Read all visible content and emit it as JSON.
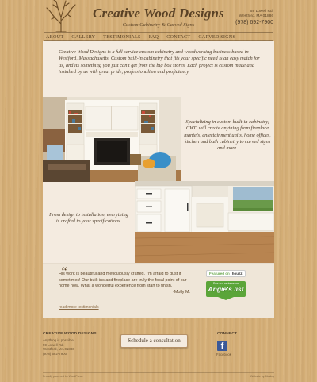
{
  "header": {
    "title": "Creative Wood Designs",
    "tagline": "Custom Cabinetry & Carved Signs",
    "address_line1": "59 Lowell Rd.",
    "address_line2": "Westford, MA 01886",
    "phone": "(978) 692-7900"
  },
  "nav": [
    "ABOUT",
    "GALLERY",
    "TESTIMONIALS",
    "FAQ",
    "CONTACT",
    "CARVED SIGNS"
  ],
  "intro": "Creative Wood Designs is a full service custom cabinetry and woodworking business based in Westford, Massachusetts. Custom built-in cabinetry that fits your specific need is an easy match for us, and its something you just can't get from the big box stores. Each project is custom made and installed by us with great pride, professionalism and proficiency.",
  "blurb1": "Specializing in custom built-in cabinetry, CWD will create anything from fireplace mantels, entertainment units, home offices, kitchen and bath cabinetry to carved signs and more.",
  "blurb2": "From design to installation, everything is crafted to your specifications.",
  "testimonial": {
    "quote_mark": "“",
    "text": "His work is beautiful and meticulously crafted. I'm afraid to dust it sometimes! Our built ins and fireplace are truly the focal point of our home now. What a wonderful experience from start to finish.",
    "author": "-Molly M.",
    "read_more": "read more testimonials"
  },
  "badges": {
    "houzz_prefix": "Featured on",
    "houzz_brand": "houzz",
    "angies_small": "See our reviews on",
    "angies_big": "Angie's list"
  },
  "footer": {
    "company_heading": "CREATIVE WOOD DESIGNS",
    "lines": [
      "Anything is possible",
      "59 Lowell Rd.",
      "Westford, MA 01886",
      "(978) 692-7900"
    ],
    "cta": "Schedule a consultation",
    "connect_heading": "CONNECT",
    "facebook_label": "Facebook",
    "facebook_glyph": "f",
    "bottom_left": "Proudly powered by WordPress",
    "bottom_right": "Website by Mosley"
  },
  "colors": {
    "background": "#d8b27a",
    "panel": "#f4ebe0",
    "text_brown": "#5a4226",
    "facebook": "#3b5998",
    "angies_green": "#5ba539"
  }
}
